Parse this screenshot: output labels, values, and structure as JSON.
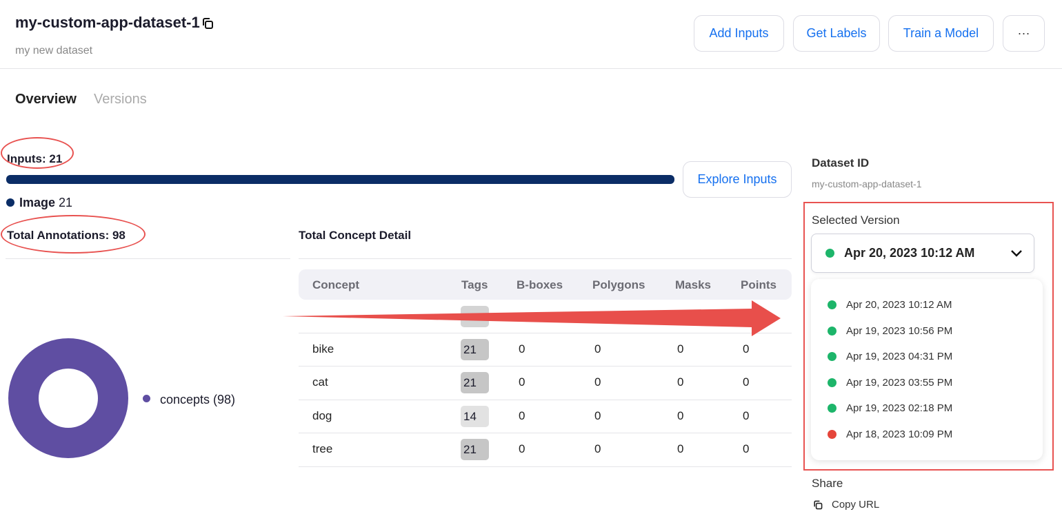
{
  "header": {
    "title": "my-custom-app-dataset-1",
    "subtitle": "my new dataset",
    "buttons": [
      "Add Inputs",
      "Get Labels",
      "Train a Model",
      "···"
    ]
  },
  "tabs": [
    "Overview",
    "Versions"
  ],
  "inputs": {
    "label": "Inputs: 21",
    "explore": "Explore Inputs",
    "legend_label": "Image",
    "legend_value": "21",
    "fraction": 1.0,
    "color": "#0b2d66"
  },
  "annotations": {
    "label": "Total Annotations: 98",
    "legend": "concepts (98)",
    "color": "#5f4ea2"
  },
  "concepts": {
    "title": "Total Concept Detail",
    "columns": [
      "Concept",
      "Tags",
      "B-boxes",
      "Polygons",
      "Masks",
      "Points"
    ],
    "rows": [
      {
        "concept": "bike",
        "tags": "21",
        "bboxes": "0",
        "polygons": "0",
        "masks": "0",
        "points": "0"
      },
      {
        "concept": "cat",
        "tags": "21",
        "bboxes": "0",
        "polygons": "0",
        "masks": "0",
        "points": "0"
      },
      {
        "concept": "dog",
        "tags": "14",
        "bboxes": "0",
        "polygons": "0",
        "masks": "0",
        "points": "0"
      },
      {
        "concept": "tree",
        "tags": "21",
        "bboxes": "0",
        "polygons": "0",
        "masks": "0",
        "points": "0"
      }
    ]
  },
  "side": {
    "dataset_id_label": "Dataset ID",
    "dataset_id": "my-custom-app-dataset-1",
    "selected_version_label": "Selected Version",
    "selected_version": "Apr 20, 2023 10:12 AM",
    "versions": [
      {
        "label": "Apr 20, 2023 10:12 AM",
        "color": "#1db56a"
      },
      {
        "label": "Apr 19, 2023 10:56 PM",
        "color": "#1db56a"
      },
      {
        "label": "Apr 19, 2023 04:31 PM",
        "color": "#1db56a"
      },
      {
        "label": "Apr 19, 2023 03:55 PM",
        "color": "#1db56a"
      },
      {
        "label": "Apr 19, 2023 02:18 PM",
        "color": "#1db56a"
      },
      {
        "label": "Apr 18, 2023 10:09 PM",
        "color": "#e5453a"
      }
    ],
    "share_label": "Share",
    "copy_url": "Copy URL"
  }
}
